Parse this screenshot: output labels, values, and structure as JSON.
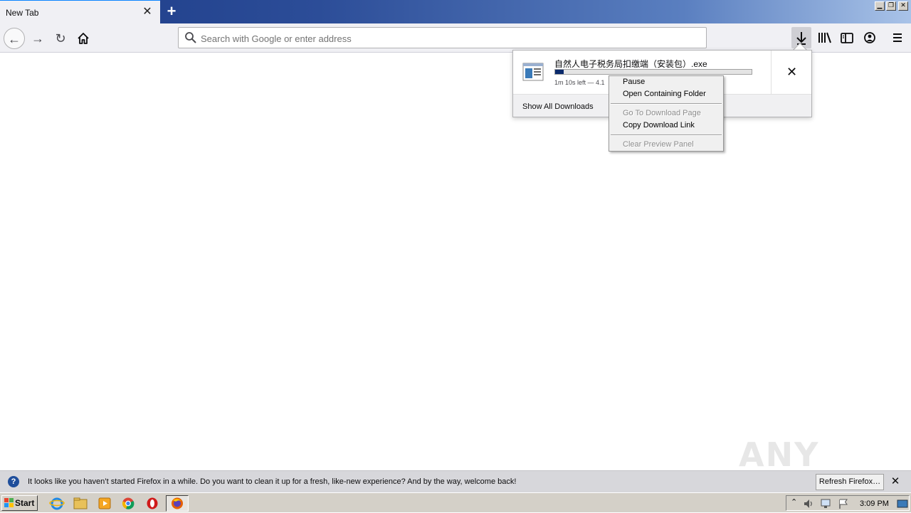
{
  "window": {
    "tab_title": "New Tab",
    "tab_close_glyph": "✕",
    "new_tab_glyph": "+",
    "minimize_glyph": "▁",
    "restore_glyph": "❐",
    "close_glyph": "✕"
  },
  "toolbar": {
    "back_glyph": "←",
    "forward_glyph": "→",
    "reload_glyph": "↻",
    "url_placeholder": "Search with Google or enter address",
    "url_value": ""
  },
  "downloads_panel": {
    "filename": "自然人电子税务局扣缴端（安装包）.exe",
    "status": "1m 10s left — 4.1",
    "progress": 0.045,
    "cancel_glyph": "✕",
    "show_all_label": "Show All Downloads"
  },
  "context_menu": {
    "items": [
      {
        "label": "Pause",
        "enabled": true
      },
      {
        "label": "Open Containing Folder",
        "enabled": true
      },
      {
        "label": "Go To Download Page",
        "enabled": false
      },
      {
        "label": "Copy Download Link",
        "enabled": true
      },
      {
        "label": "Clear Preview Panel",
        "enabled": false
      }
    ]
  },
  "notification": {
    "icon_glyph": "?",
    "text": "It looks like you haven’t started Firefox in a while. Do you want to clean it up for a fresh, like-new experience? And by the way, welcome back!",
    "button_label": "Refresh Firefox…",
    "close_glyph": "✕"
  },
  "watermark": "ANY RUN",
  "taskbar": {
    "start_label": "Start",
    "time": "3:09 PM",
    "apps": [
      "ie-icon",
      "explorer-icon",
      "media-player-icon",
      "chrome-icon",
      "opera-icon",
      "firefox-icon"
    ]
  },
  "colors": {
    "accent": "#0a84ff",
    "progress_fill": "#0a2a6b",
    "titlebar_start": "#1b3a86",
    "titlebar_end": "#a9c3e8"
  }
}
